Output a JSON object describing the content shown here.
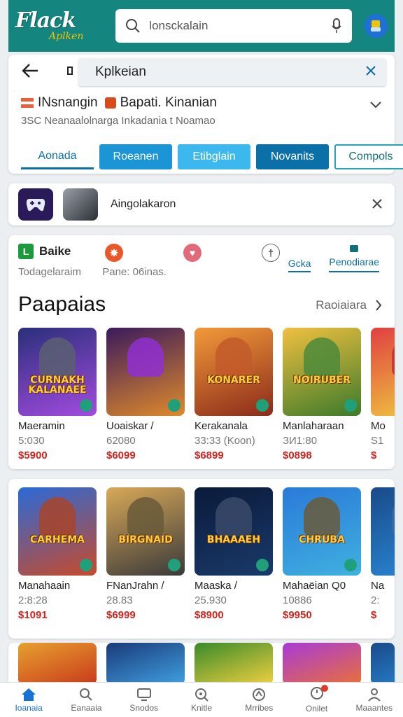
{
  "header": {
    "logo_main": "Flack",
    "logo_sub": "Aplken",
    "search_value": "lonsckalain"
  },
  "nav": {
    "breadcrumb": "Kplkeian",
    "filter_label_1": "INsnangin",
    "filter_label_2": "Bapati. Kinanian",
    "filter_sub": "3SC Neanaalolnarga Inkadania t Noamao",
    "tabs": [
      "Aonada",
      "Roeanen",
      "Etibglain",
      "Novanits",
      "Compols"
    ]
  },
  "suggestion": {
    "text": "Aingolakaron"
  },
  "info": {
    "item1": "Baike",
    "sub1": "Todagelaraim",
    "sub2": "Pane: 06inas.",
    "filter_tabs": [
      "Gcka",
      "Penodiarae"
    ]
  },
  "section": {
    "title": "Paapaias",
    "more": "Raoiaiara"
  },
  "games_row1": [
    {
      "name": "Maeramin",
      "meta": "5:030",
      "price": "$5900",
      "art": "CURNAKH KALANAEE",
      "bg1": "#2b2f7a",
      "bg2": "#a24be0",
      "fig": "#5b5f72"
    },
    {
      "name": "Uoaiskar /",
      "meta": "62080",
      "price": "$6099",
      "art": "",
      "bg1": "#3a1a5c",
      "bg2": "#e08a2b",
      "fig": "#8f2fd2"
    },
    {
      "name": "Kerakanala",
      "meta": "33:33 (Koon)",
      "price": "$6899",
      "art": "KONARER",
      "bg1": "#f29a3a",
      "bg2": "#8b2a1a",
      "fig": "#c25a2a"
    },
    {
      "name": "Manlaharaan",
      "meta": "ЗИ1:80",
      "price": "$0898",
      "art": "NOIRUBER",
      "bg1": "#f0c040",
      "bg2": "#3c7a2a",
      "fig": "#4e8a3a"
    },
    {
      "name": "Mo",
      "meta": "S1",
      "price": "$",
      "art": "",
      "bg1": "#e04040",
      "bg2": "#f0d040",
      "fig": "#c03030"
    }
  ],
  "games_row2": [
    {
      "name": "Manahaain",
      "meta": "2:8:28",
      "price": "$1091",
      "art": "CARHEMA",
      "bg1": "#2a6ad8",
      "bg2": "#c84a2a",
      "fig": "#a8442a"
    },
    {
      "name": "FNanJrahn /",
      "meta": "28.83",
      "price": "$6999",
      "art": "BIRGNAID",
      "bg1": "#d8a858",
      "bg2": "#3a3a3a",
      "fig": "#6a5a3a"
    },
    {
      "name": "Maaska /",
      "meta": "25.930",
      "price": "$8900",
      "art": "BHAAAEH",
      "bg1": "#0a1a3a",
      "bg2": "#1a3a6a",
      "fig": "#3a4a6a"
    },
    {
      "name": "Mahaёian Q0",
      "meta": "10886",
      "price": "$9950",
      "art": "CHRUBA",
      "bg1": "#2a7ad8",
      "bg2": "#40b0e0",
      "fig": "#6a5a3a"
    },
    {
      "name": "Na",
      "meta": "2:",
      "price": "$",
      "art": "",
      "bg1": "#1a4a8a",
      "bg2": "#2a8ad8",
      "fig": "#3a6aaa"
    }
  ],
  "games_row3": [
    {
      "bg1": "#e8a030",
      "bg2": "#c83a1a"
    },
    {
      "bg1": "#1a3a7a",
      "bg2": "#40a0e0"
    },
    {
      "bg1": "#3a8a2a",
      "bg2": "#f0d040"
    },
    {
      "bg1": "#a83ad8",
      "bg2": "#e8703a"
    },
    {
      "bg1": "#1a4a8a",
      "bg2": "#2a8ad8"
    }
  ],
  "bottom_nav": [
    "Ioanaia",
    "Eanaaia",
    "Snodos",
    "Knitle",
    "Mrribes",
    "Onilet",
    "Maaantes"
  ],
  "colors": {
    "header": "#14857f",
    "price": "#d2231d",
    "accent": "#1774d1"
  }
}
